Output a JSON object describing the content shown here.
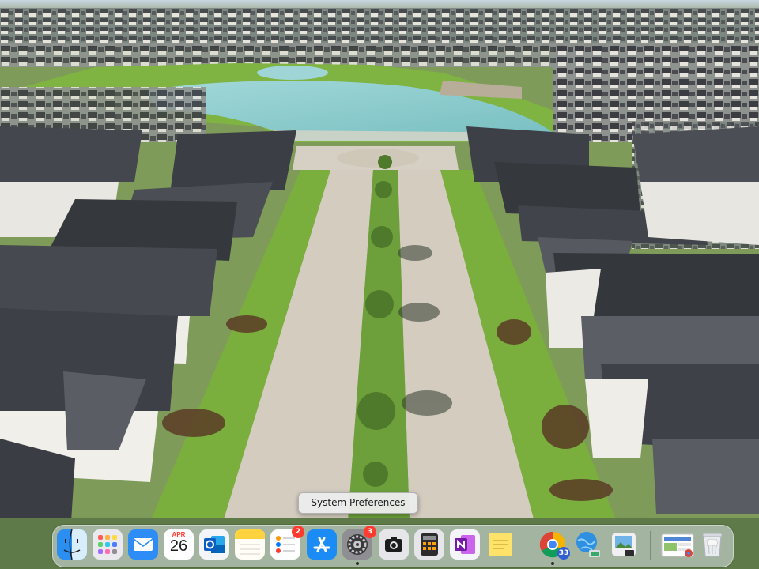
{
  "tooltip": {
    "text": "System Preferences"
  },
  "calendar": {
    "month": "APR",
    "day": "26"
  },
  "badges": {
    "reminders": "2",
    "system_preferences": "3",
    "chrome": "33"
  },
  "dock_items": [
    "finder",
    "launchpad",
    "mail",
    "calendar",
    "outlook",
    "notes",
    "reminders",
    "app-store",
    "system-preferences",
    "screenshot",
    "calculator",
    "onenote",
    "stickies",
    "chrome",
    "network-utility",
    "preview",
    "photos-folder",
    "trash"
  ],
  "colors": {
    "water": "#8dcfd0",
    "grass": "#6fa83b",
    "roof": "#3e4147",
    "road": "#d3ccbf",
    "badge": "#ff3b30"
  }
}
